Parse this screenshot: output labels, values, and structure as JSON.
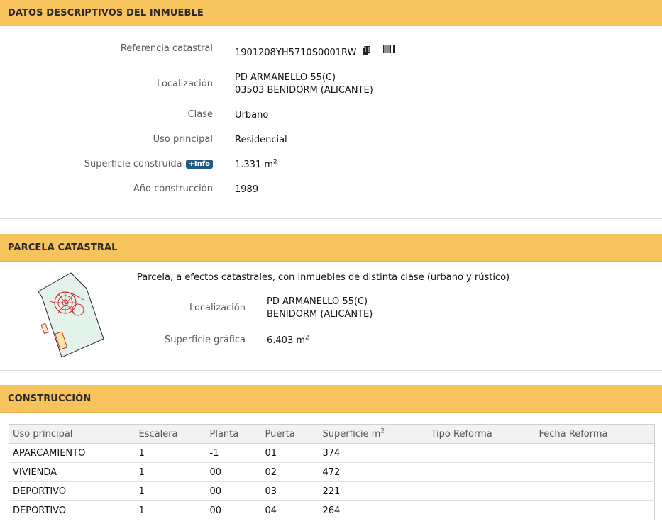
{
  "datos": {
    "title": "DATOS DESCRIPTIVOS DEL INMUEBLE",
    "ref_label": "Referencia catastral",
    "ref_value": "1901208YH5710S0001RW",
    "loc_label": "Localización",
    "loc_line1": "PD ARMANELLO 55(C)",
    "loc_line2": "03503 BENIDORM (ALICANTE)",
    "clase_label": "Clase",
    "clase_value": "Urbano",
    "uso_label": "Uso principal",
    "uso_value": "Residencial",
    "sup_label": "Superficie construida",
    "info_label": "+Info",
    "sup_value": "1.331 m",
    "sup_unit_sup": "2",
    "anio_label": "Año construcción",
    "anio_value": "1989"
  },
  "parcela": {
    "title": "PARCELA CATASTRAL",
    "description": "Parcela, a efectos catastrales, con inmuebles de distinta clase (urbano y rústico)",
    "loc_label": "Localización",
    "loc_line1": "PD ARMANELLO 55(C)",
    "loc_line2": "BENIDORM (ALICANTE)",
    "sup_label": "Superficie gráfica",
    "sup_value": "6.403 m",
    "sup_unit_sup": "2"
  },
  "construccion": {
    "title": "CONSTRUCCIÓN",
    "headers": [
      "Uso principal",
      "Escalera",
      "Planta",
      "Puerta",
      "Superficie m",
      "Tipo Reforma",
      "Fecha Reforma"
    ],
    "sup_header_sup": "2",
    "rows": [
      [
        "APARCAMIENTO",
        "1",
        "-1",
        "01",
        "374",
        "",
        ""
      ],
      [
        "VIVIENDA",
        "1",
        "00",
        "02",
        "472",
        "",
        ""
      ],
      [
        "DEPORTIVO",
        "1",
        "00",
        "03",
        "221",
        "",
        ""
      ],
      [
        "DEPORTIVO",
        "1",
        "00",
        "04",
        "264",
        "",
        ""
      ]
    ]
  },
  "icons": {
    "copy": "copy-icon",
    "barcode": "barcode-icon",
    "parcel_map": "parcel-map-thumbnail"
  },
  "colors": {
    "header_bg": "#f7c35c",
    "info_badge": "#225a80",
    "parcel_outline": "#d42a2a",
    "parcel_fill": "#e4f2ec"
  }
}
